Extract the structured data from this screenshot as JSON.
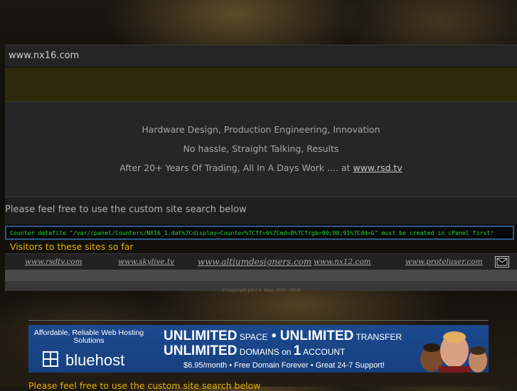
{
  "site": {
    "title": "www.nx16.com"
  },
  "info": {
    "line1": "Hardware Design, Production Engineering, Innovation",
    "line2": "No hassle, Straight Talking, Results",
    "line3_prefix": "After 20+ Years Of Trading, All In A Days Work  .... at ",
    "line3_link": "www.rsd.tv"
  },
  "search": {
    "text": "Please feel free to use the custom site search below"
  },
  "counter": {
    "error_text": "Counter datafile \"/var/cpanel/Counters/NX16_1.dat%7Cdisplay=Counter%7Cft=6%7Cmd=8%7Cfrgb=90;90;91%7Cdd=G\" must be created in cPanel first!"
  },
  "visitors": {
    "text": "Visitors to these sites so far"
  },
  "sites": [
    {
      "label": "www.rsdtv.com"
    },
    {
      "label": "www.skylive.tv"
    },
    {
      "label": "www.altiumdesigners.com"
    },
    {
      "label": "www.nx12.com"
    },
    {
      "label": "www.proteluser.com"
    }
  ],
  "footer": {
    "copyright": "©Copyright John A. Ross 2007~2009"
  },
  "banner": {
    "tagline": "Affordable, Reliable Web Hosting Solutions",
    "brand": "bluehost",
    "line1_a": "UNLIMITED",
    "line1_b": " SPACE",
    "line1_sep": " • ",
    "line1_c": "UNLIMITED",
    "line1_d": " TRANSFER",
    "line2_a": "UNLIMITED",
    "line2_b": " DOMAINS",
    "line2_c": " on ",
    "line2_d": "1",
    "line2_e": " ACCOUNT",
    "line3": "$6.95/month  •  Free Domain Forever  •  Great 24-7 Support!"
  },
  "bottom": {
    "text": "Please feel free to use the custom site search below"
  },
  "colors": {
    "accent": "#e6b000",
    "counter_green": "#1fdc35",
    "banner_blue": "#1c4a8f"
  }
}
